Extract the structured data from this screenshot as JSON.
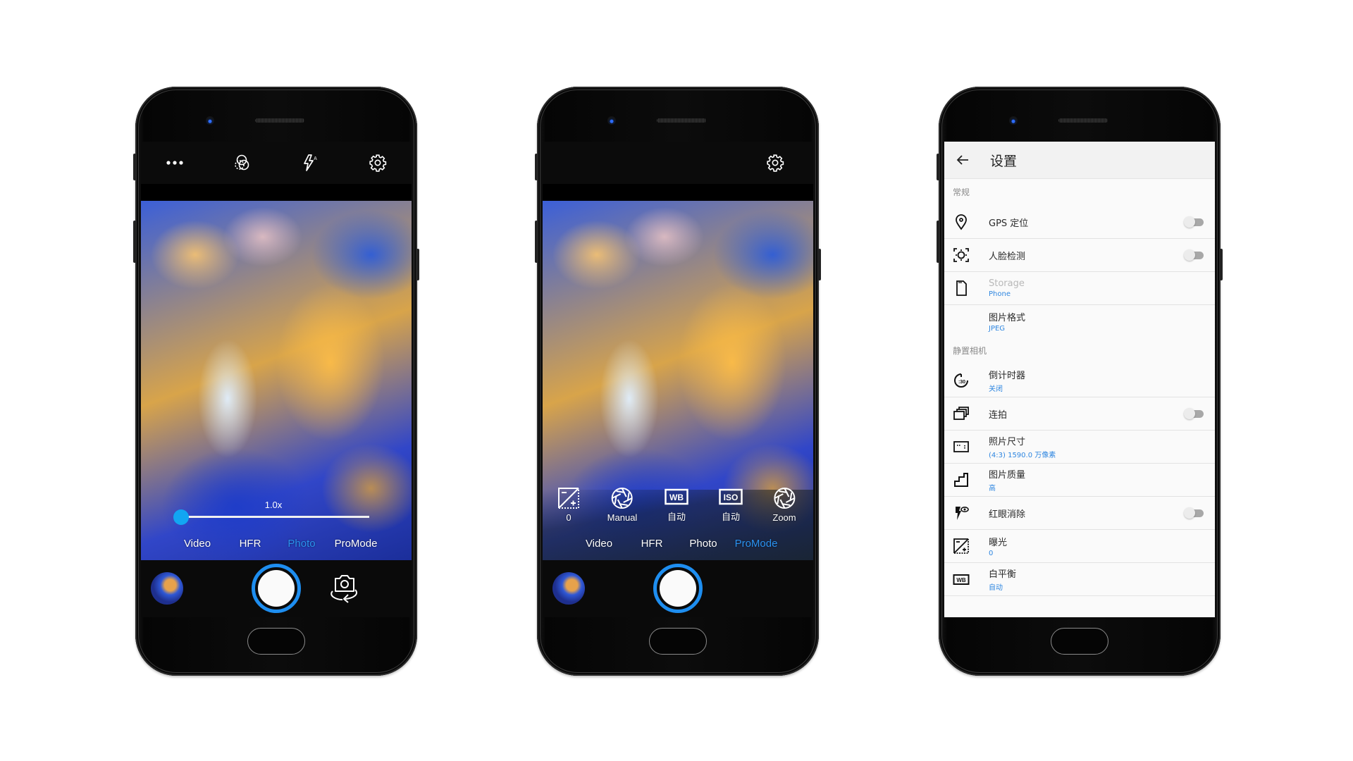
{
  "phones": [
    {
      "screen": "camera-photo",
      "top_icons": [
        "more-icon",
        "filter-icon",
        "flash-auto-icon",
        "settings-gear-icon"
      ],
      "zoom_level": "1.0x",
      "zoom_fraction": 0.0,
      "modes": [
        "Video",
        "HFR",
        "Photo",
        "ProMode"
      ],
      "active_mode": "Photo",
      "bottom": {
        "thumbnail": "gallery-thumbnail",
        "shutter": "shutter-button",
        "switch_camera": "switch-camera-icon"
      }
    },
    {
      "screen": "camera-promode",
      "top_icons": [
        "settings-gear-icon"
      ],
      "pro_controls": [
        {
          "icon": "exposure-icon",
          "label": "0"
        },
        {
          "icon": "aperture-icon",
          "label": "Manual"
        },
        {
          "icon": "wb-icon",
          "label": "自动"
        },
        {
          "icon": "iso-icon",
          "label": "自动"
        },
        {
          "icon": "aperture-zoom-icon",
          "label": "Zoom"
        }
      ],
      "modes": [
        "Video",
        "HFR",
        "Photo",
        "ProMode"
      ],
      "active_mode": "ProMode",
      "bottom": {
        "thumbnail": "gallery-thumbnail",
        "shutter": "shutter-button"
      }
    },
    {
      "screen": "settings",
      "header": {
        "back_icon": "arrow-left-icon",
        "title": "设置"
      },
      "sections": [
        {
          "title": "常规",
          "rows": [
            {
              "icon": "location-pin-icon",
              "title": "GPS 定位",
              "subtitle": "",
              "toggle": true,
              "toggle_on": false
            },
            {
              "icon": "face-detect-icon",
              "title": "人脸检测",
              "subtitle": "",
              "toggle": true,
              "toggle_on": false
            },
            {
              "icon": "sd-card-icon",
              "title": "Storage",
              "subtitle": "Phone",
              "toggle": false,
              "disabled": true
            },
            {
              "icon": "",
              "title": "图片格式",
              "subtitle": "JPEG",
              "toggle": false
            }
          ]
        },
        {
          "title": "静置相机",
          "rows": [
            {
              "icon": "timer-icon",
              "title": "倒计时器",
              "subtitle": "关闭",
              "toggle": false
            },
            {
              "icon": "burst-icon",
              "title": "连拍",
              "subtitle": "",
              "toggle": true,
              "toggle_on": false
            },
            {
              "icon": "photo-size-icon",
              "title": "照片尺寸",
              "subtitle": "(4:3) 1590.0 万像素",
              "toggle": false
            },
            {
              "icon": "quality-icon",
              "title": "图片质量",
              "subtitle": "高",
              "toggle": false
            },
            {
              "icon": "red-eye-icon",
              "title": "红眼消除",
              "subtitle": "",
              "toggle": true,
              "toggle_on": false
            },
            {
              "icon": "exposure-icon",
              "title": "曝光",
              "subtitle": "0",
              "toggle": false
            },
            {
              "icon": "wb-icon",
              "title": "白平衡",
              "subtitle": "自动",
              "toggle": false
            }
          ]
        }
      ]
    }
  ],
  "colors": {
    "accent_blue": "#1e8ef0",
    "active_mode_blue": "#2a92f0",
    "settings_subtitle_blue": "#2e86e0",
    "zoom_knob": "#12a6f2"
  }
}
